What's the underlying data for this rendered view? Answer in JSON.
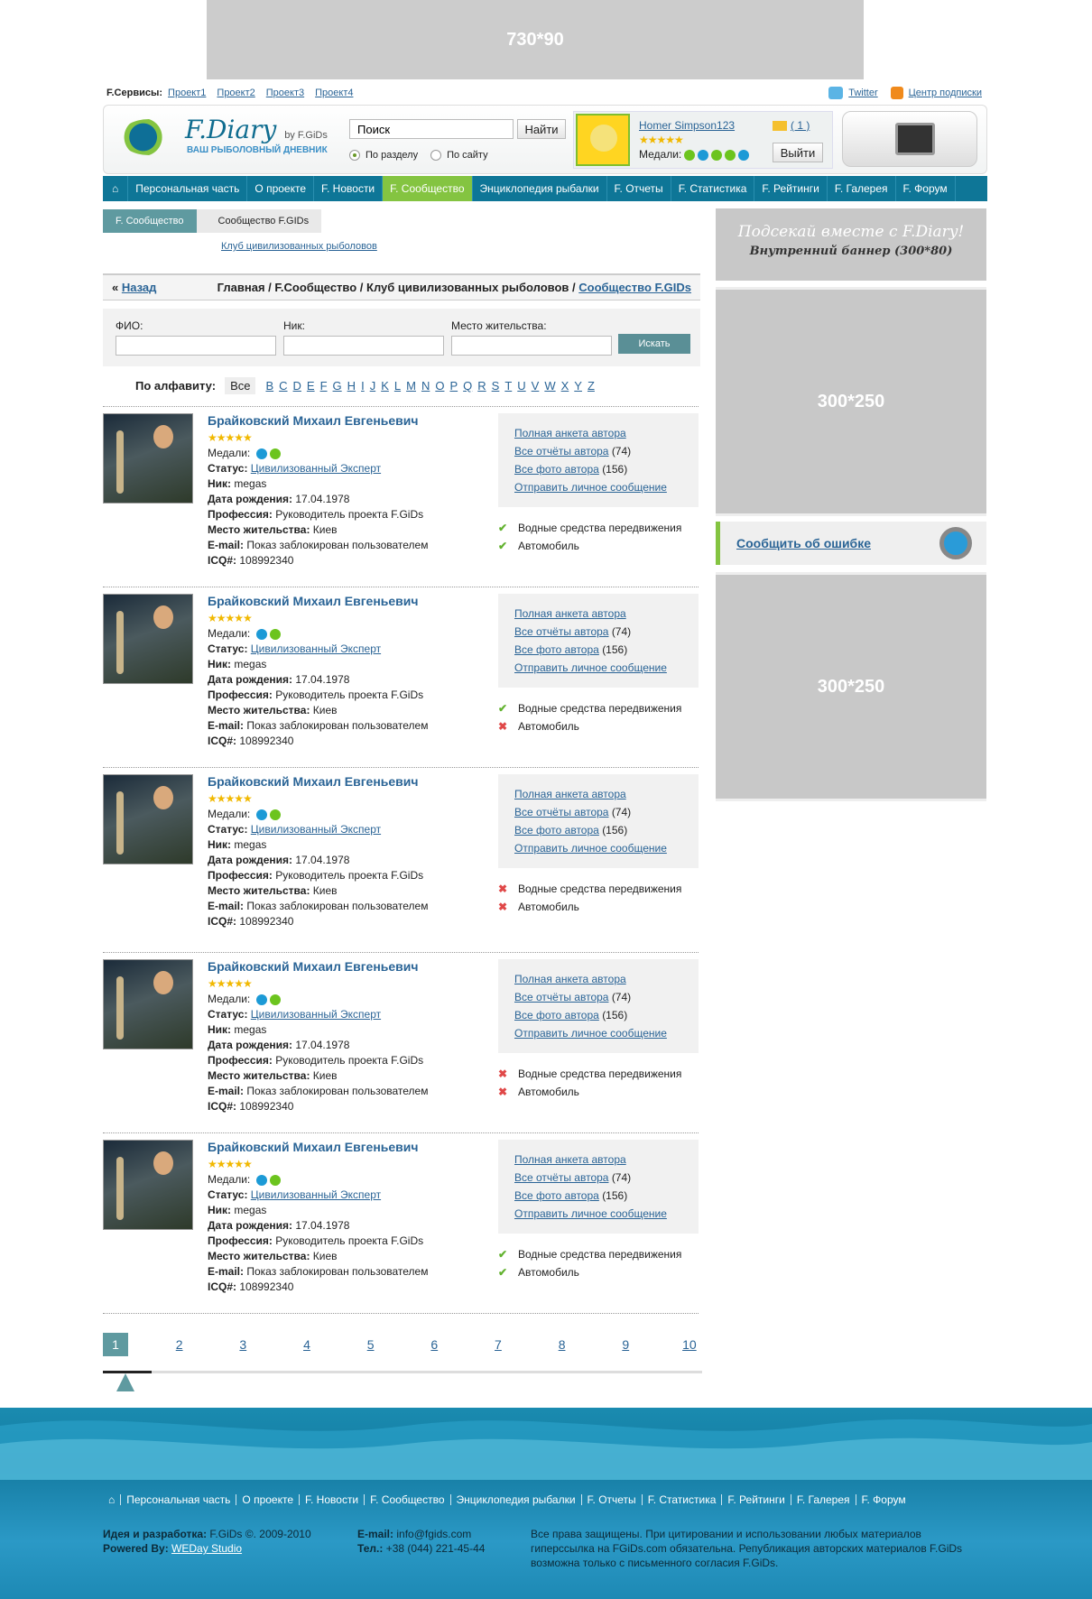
{
  "top_banner": "730*90",
  "services": {
    "label": "F.Сервисы:",
    "projects": [
      "Проект1",
      "Проект2",
      "Проект3",
      "Проект4"
    ],
    "twitter": "Twitter",
    "subscribe": "Центр подписки"
  },
  "logo": {
    "title": "F.Diary",
    "by": "by F.GiDs",
    "subtitle": "ВАШ РЫБОЛОВНЫЙ ДНЕВНИК"
  },
  "search": {
    "value": "Поиск",
    "button": "Найти",
    "radio1": "По разделу",
    "radio2": "По сайту"
  },
  "user": {
    "name": "Homer Simpson123",
    "medals_label": "Медали:",
    "mail_count": "( 1 )",
    "logout": "Выйти",
    "stars": "★★★★★"
  },
  "nav": [
    "Персональная часть",
    "О проекте",
    "F. Новости",
    "F. Сообщество",
    "Энциклопедия рыбалки",
    "F. Отчеты",
    "F. Статистика",
    "F. Рейтинги",
    "F. Галерея",
    "F. Форум"
  ],
  "nav_active": "F. Сообщество",
  "tabs": {
    "t1": "F. Сообщество",
    "t2": "Сообщество F.GIDs"
  },
  "sub_link": "Клуб цивилизованных рыболовов",
  "pathbar": {
    "back_prefix": "«",
    "back": "Назад",
    "p1": "Главная",
    "p2": "F.Сообщество",
    "p3": "Клуб цивилизованных рыболовов",
    "p4": "Сообщество F.GIDs",
    "sep": " / "
  },
  "filter": {
    "fio": "ФИО:",
    "nick": "Ник:",
    "place": "Место жительства:",
    "go": "Искать"
  },
  "alpha": {
    "label": "По алфавиту:",
    "all": "Все",
    "letters": [
      "B",
      "C",
      "D",
      "E",
      "F",
      "G",
      "H",
      "I",
      "J",
      "K",
      "L",
      "M",
      "N",
      "O",
      "P",
      "Q",
      "R",
      "S",
      "T",
      "U",
      "V",
      "W",
      "X",
      "Y",
      "Z"
    ]
  },
  "card": {
    "name": "Брайковский Михаил Евгеньевич",
    "stars": "★★★★★",
    "medals_label": "Медали:",
    "status_label": "Статус:",
    "status": "Цивилизованный Эксперт",
    "nick_label": "Ник:",
    "nick": "megas",
    "birth_label": "Дата рождения:",
    "birth": "17.04.1978",
    "prof_label": "Профессия:",
    "prof": "Руководитель проекта F.GiDs",
    "place_label": "Место жительства:",
    "place": "Киев",
    "email_label": "E-mail:",
    "email": "Показ заблокирован пользователем",
    "icq_label": "ICQ#:",
    "icq": "108992340",
    "link1": "Полная анкета автора",
    "link2": "Все отчёты автора",
    "link2_count": "(74)",
    "link3": "Все фото автора",
    "link3_count": "(156)",
    "link4": "Отправить личное сообщение",
    "check1": "Водные средства передвижения",
    "check2": "Автомобиль"
  },
  "cards_checks": [
    [
      true,
      true
    ],
    [
      true,
      false
    ],
    [
      false,
      false
    ],
    [
      false,
      false
    ],
    [
      true,
      true
    ]
  ],
  "pager": [
    "1",
    "2",
    "3",
    "4",
    "5",
    "6",
    "7",
    "8",
    "9",
    "10"
  ],
  "pager_current": "1",
  "side": {
    "banner_a": "Подсекай вместе с F.Diary!",
    "banner_b": "Внутренний баннер (300*80)",
    "ad1": "300*250",
    "report": "Сообщить об ошибке",
    "ad2": "300*250"
  },
  "footer": {
    "nav": [
      "Персональная часть",
      "О проекте",
      "F. Новости",
      "F. Сообщество",
      "Энциклопедия рыбалки",
      "F. Отчеты",
      "F. Статистика",
      "F. Рейтинги",
      "F. Галерея",
      "F. Форум"
    ],
    "idea_label": "Идея и разработка:",
    "idea": "F.GiDs ©. 2009-2010",
    "powered_label": "Powered By:",
    "powered": "WEDay Studio",
    "email_label": "E-mail:",
    "email": "info@fgids.com",
    "phone_label": "Тел.:",
    "phone": "+38 (044) 221-45-44",
    "rights": "Все права защищены. При цитировании и использовании любых материалов гиперссылка на FGiDs.com обязательна. Републикация авторских материалов F.GiDs возможна только с письменного согласия F.GiDs."
  },
  "colors": {
    "nav": "#0e7697",
    "active": "#84c441",
    "accent": "#5f9aa0",
    "link": "#2a6496"
  }
}
